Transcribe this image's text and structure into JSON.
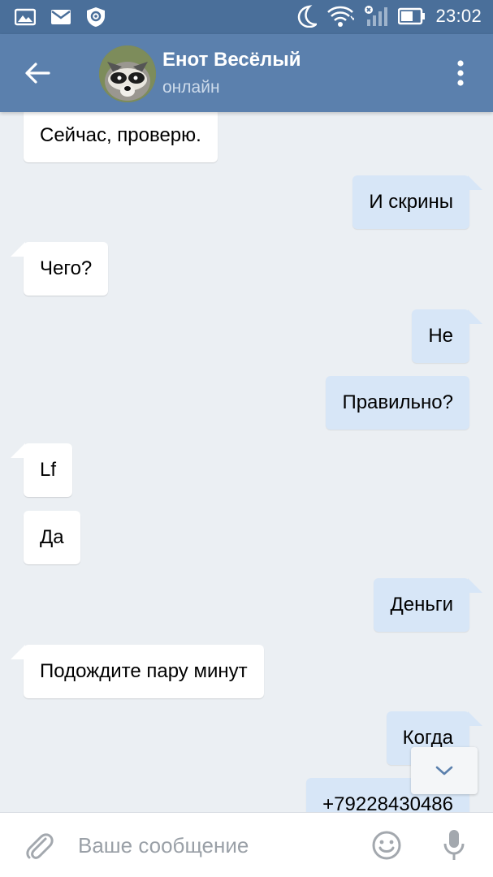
{
  "status_bar": {
    "time": "23:02",
    "left_icons": [
      "gallery-icon",
      "mail-icon",
      "shield-icon"
    ],
    "right_icons": [
      "moon-icon",
      "wifi-icon",
      "signal-icon",
      "battery-icon"
    ]
  },
  "header": {
    "title": "Енот Весёлый",
    "status": "онлайн",
    "back_icon": "arrow-left-icon",
    "menu_icon": "more-vertical-icon"
  },
  "messages": [
    {
      "dir": "in",
      "text": "Сейчас, проверю.",
      "tail": false
    },
    {
      "dir": "out",
      "text": "И скрины",
      "tail": true
    },
    {
      "dir": "in",
      "text": "Чего?",
      "tail": true
    },
    {
      "dir": "out",
      "text": "Не",
      "tail": true
    },
    {
      "dir": "out",
      "text": "Правильно?",
      "tail": false
    },
    {
      "dir": "in",
      "text": "Lf",
      "tail": true
    },
    {
      "dir": "in",
      "text": "Да",
      "tail": false
    },
    {
      "dir": "out",
      "text": "Деньги",
      "tail": true
    },
    {
      "dir": "in",
      "text": "Подождите пару минут",
      "tail": true
    },
    {
      "dir": "out",
      "text": "Когда",
      "tail": true
    },
    {
      "dir": "out",
      "text": "+79228430486",
      "tail": false
    }
  ],
  "composer": {
    "placeholder": "Ваше сообщение",
    "attach_icon": "paperclip-icon",
    "emoji_icon": "smiley-icon",
    "mic_icon": "microphone-icon"
  },
  "colors": {
    "status_bar": "#4a6f9a",
    "header": "#5b80ad",
    "background": "#ebeff3",
    "incoming_bubble": "#ffffff",
    "outgoing_bubble": "#d7e6f7"
  }
}
